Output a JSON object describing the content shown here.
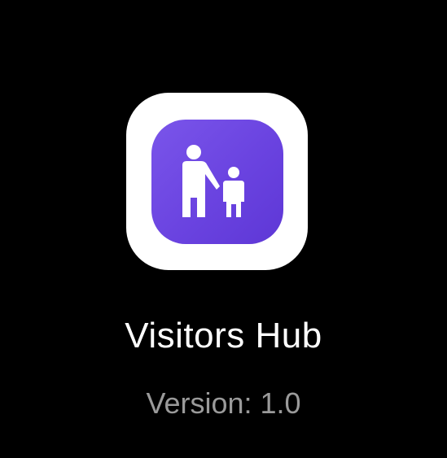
{
  "app": {
    "name": "Visitors Hub",
    "version": "Version: 1.0",
    "icon": "parent-child-icon"
  },
  "colors": {
    "background": "#000000",
    "icon_tile": "#ffffff",
    "icon_accent": "#6a43e0",
    "name_text": "#ffffff",
    "version_text": "#9a9a9a"
  }
}
